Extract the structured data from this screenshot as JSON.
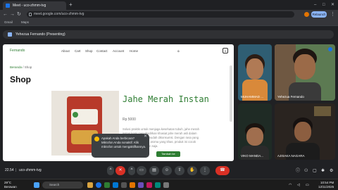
{
  "browser": {
    "tab_title": "Meet - uco-zhmm-tvg",
    "new_tab": "+",
    "url": "meet.google.com/uco-zhmm-tvg",
    "relaunch_label": "Relaunch",
    "bookmarks": [
      "Gmail",
      "Maps"
    ]
  },
  "meet": {
    "presenting_label": "Yehezua Fernando (Presenting)",
    "time": "22.54",
    "meeting_code": "uco-zhmm-tvg"
  },
  "shared_site": {
    "brand": "Fernando",
    "nav": [
      "About",
      "Cart",
      "Shop",
      "Contact",
      "Account",
      "Home"
    ],
    "breadcrumb_home": "Beranda",
    "breadcrumb_current": "Shop",
    "page_title": "Shop",
    "product_name": "Jahe Merah Instan",
    "price": "Rp 5000",
    "description": "Solusi praktis untuk menjaga kesehatan tubuh, jahe merah instan kami menghadirkan khasiat jahe merah asli dalam bentuk bubuk yang mudah dikonsumsi. Dengan rasa yang menghangatkan dan aroma yang khas, produk ini cocok untuk dinikmati kapan saja.",
    "cart_count": "0",
    "buy_button": "Tambah ke keranjang"
  },
  "popup": {
    "text": "Apakah Anda berbicara? Mikrofon Anda nonaktif. Klik mikrofon untuk mengaktifkannya."
  },
  "participants": [
    {
      "name": "MUHAMMAD ..."
    },
    {
      "name": "Yehezua Fernando"
    },
    {
      "name": "VIKO MANDA..."
    },
    {
      "name": "AJISAKA NAGARA"
    }
  ],
  "taskbar": {
    "weather_temp": "29°C",
    "weather_desc": "Berawan",
    "search_placeholder": "Search",
    "time": "10:54 PM",
    "date": "12/11/2025"
  },
  "colors": {
    "accent_green": "#2e7d32",
    "hangup_red": "#d93025",
    "meet_blue": "#8ab4f8"
  }
}
